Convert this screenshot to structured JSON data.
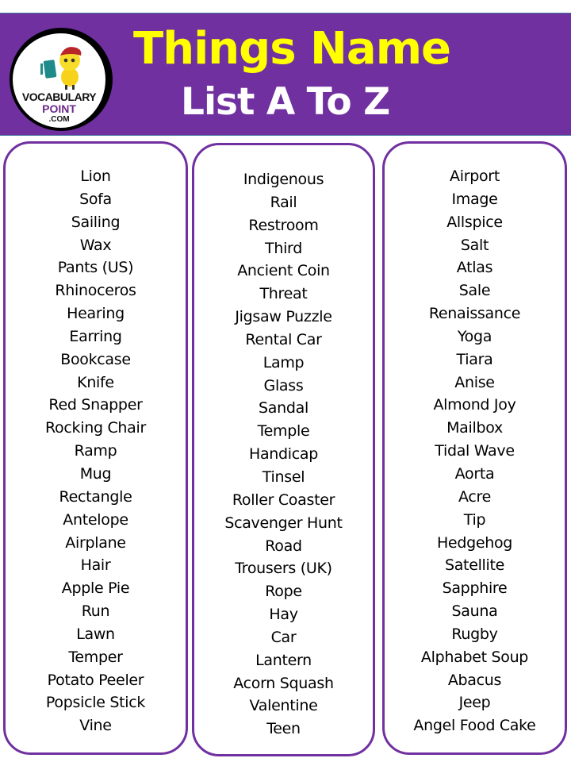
{
  "header": {
    "title_line_1": "Things Name",
    "title_line_2": "List A To Z",
    "title_color": "#ffff00",
    "subtitle_color": "#ffffff",
    "background_color": "#7030a0"
  },
  "logo": {
    "line_1": "VOCABULARY",
    "line_2": "POINT",
    "line_3": ".COM",
    "icon": "cartoon-kid-with-book-icon"
  },
  "columns": [
    {
      "items": [
        "Lion",
        "Sofa",
        "Sailing",
        "Wax",
        "Pants (US)",
        "Rhinoceros",
        "Hearing",
        "Earring",
        "Bookcase",
        "Knife",
        "Red Snapper",
        "Rocking Chair",
        "Ramp",
        "Mug",
        "Rectangle",
        "Antelope",
        "Airplane",
        "Hair",
        "Apple Pie",
        "Run",
        "Lawn",
        "Temper",
        "Potato Peeler",
        "Popsicle Stick",
        "Vine"
      ]
    },
    {
      "items": [
        "Indigenous",
        "Rail",
        "Restroom",
        "Third",
        "Ancient Coin",
        "Threat",
        "Jigsaw Puzzle",
        "Rental Car",
        "Lamp",
        "Glass",
        "Sandal",
        "Temple",
        "Handicap",
        "Tinsel",
        "Roller Coaster",
        "Scavenger Hunt",
        "Road",
        "Trousers (UK)",
        "Rope",
        "Hay",
        "Car",
        "Lantern",
        "Acorn Squash",
        "Valentine",
        "Teen"
      ]
    },
    {
      "items": [
        "Airport",
        "Image",
        "Allspice",
        "Salt",
        "Atlas",
        "Sale",
        "Renaissance",
        "Yoga",
        "Tiara",
        "Anise",
        "Almond Joy",
        "Mailbox",
        "Tidal Wave",
        "Aorta",
        "Acre",
        "Tip",
        "Hedgehog",
        "Satellite",
        "Sapphire",
        "Sauna",
        "Rugby",
        "Alphabet Soup",
        "Abacus",
        "Jeep",
        "Angel Food Cake"
      ]
    }
  ],
  "border_color": "#7030a0"
}
